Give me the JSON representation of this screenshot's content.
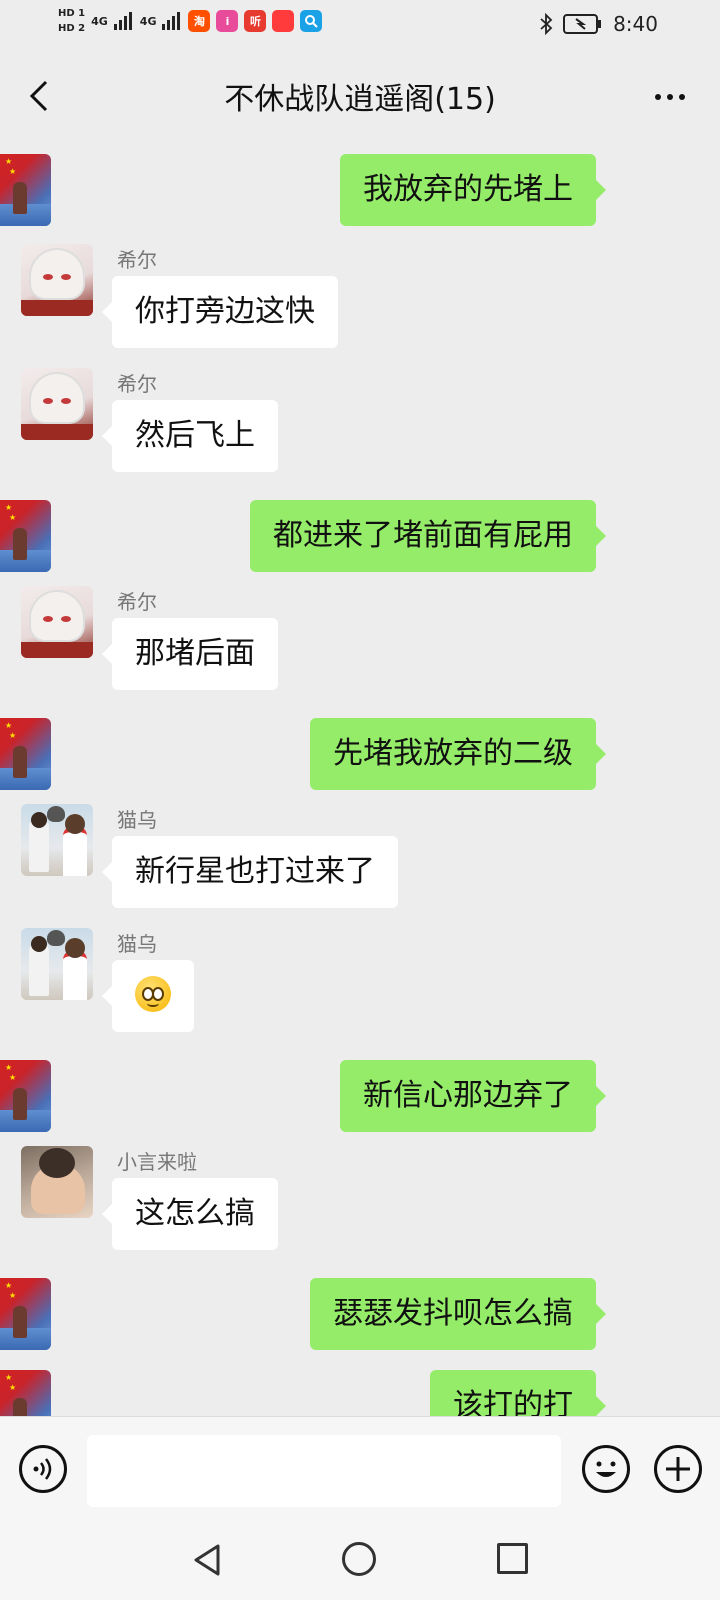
{
  "status_bar": {
    "sim1": "HD 1",
    "sim2": "HD 2",
    "network1": "4G",
    "network2": "4G",
    "apps": [
      {
        "icon": "taobao-icon",
        "label": "淘",
        "color": "#ff5000"
      },
      {
        "icon": "app-icon",
        "label": "i",
        "color": "#e94b9b"
      },
      {
        "icon": "ting-icon",
        "label": "听",
        "color": "#e63b2e"
      },
      {
        "icon": "huawei-mall-icon",
        "label": "",
        "color": "#ff3b3b"
      },
      {
        "icon": "search-app-icon",
        "label": "",
        "color": "#1aa1e6"
      }
    ],
    "time": "8:40"
  },
  "header": {
    "title": "不休战队逍遥阁(15)"
  },
  "messages": [
    {
      "side": "right",
      "avatar": "flag",
      "text": "我放弃的先堵上"
    },
    {
      "side": "left",
      "avatar": "anime",
      "sender": "希尔",
      "text": "你打旁边这快"
    },
    {
      "side": "left",
      "avatar": "anime",
      "sender": "希尔",
      "text": "然后飞上"
    },
    {
      "side": "right",
      "avatar": "flag",
      "text": "都进来了堵前面有屁用"
    },
    {
      "side": "left",
      "avatar": "anime",
      "sender": "希尔",
      "text": "那堵后面"
    },
    {
      "side": "right",
      "avatar": "flag",
      "text": "先堵我放弃的二级"
    },
    {
      "side": "left",
      "avatar": "couple",
      "sender": "猫乌",
      "text": "新行星也打过来了"
    },
    {
      "side": "left",
      "avatar": "couple",
      "sender": "猫乌",
      "text": "",
      "emoji": "grimace-emoji"
    },
    {
      "side": "right",
      "avatar": "flag",
      "text": "新信心那边弃了"
    },
    {
      "side": "left",
      "avatar": "baby",
      "sender": "小言来啦",
      "text": "这怎么搞"
    },
    {
      "side": "right",
      "avatar": "flag",
      "text": "瑟瑟发抖呗怎么搞"
    },
    {
      "side": "right",
      "avatar": "flag",
      "text": "该打的打"
    }
  ],
  "input_bar": {
    "value": "",
    "placeholder": ""
  }
}
